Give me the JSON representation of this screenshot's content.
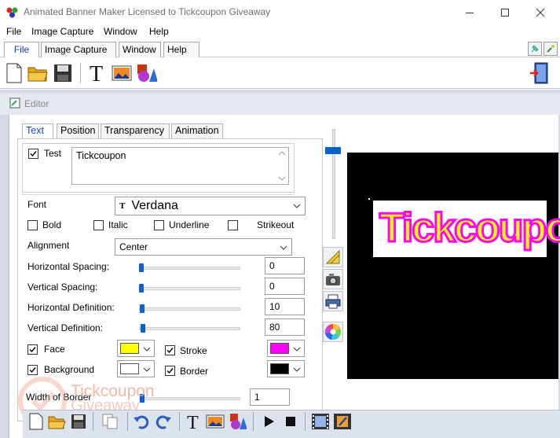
{
  "window": {
    "title": "Animated Banner Maker Licensed to Tickcoupon Giveaway",
    "controls": [
      "minimize",
      "maximize",
      "close"
    ]
  },
  "menubar": [
    "File",
    "Image Capture",
    "Window",
    "Help"
  ],
  "ribbon_tabs": [
    {
      "label": "File",
      "active": true
    },
    {
      "label": "Image Capture",
      "active": false
    },
    {
      "label": "Window",
      "active": false
    },
    {
      "label": "Help",
      "active": false
    }
  ],
  "toolbar": {
    "icons": [
      "new-file-icon",
      "open-folder-icon",
      "save-icon",
      "text-tool-icon",
      "image-icon",
      "shapes-icon"
    ],
    "right_icon": "exit-door-icon"
  },
  "editor": {
    "title": "Editor",
    "tabs": [
      {
        "label": "Text",
        "active": true
      },
      {
        "label": "Position",
        "active": false
      },
      {
        "label": "Transparency",
        "active": false
      },
      {
        "label": "Animation",
        "active": false
      }
    ],
    "text": {
      "checkbox_label": "Test",
      "checked": true,
      "value": "Tickcoupon"
    },
    "font": {
      "label": "Font",
      "value": "Verdana"
    },
    "styles": [
      {
        "label": "Bold",
        "checked": false
      },
      {
        "label": "Italic",
        "checked": false
      },
      {
        "label": "Underline",
        "checked": false
      },
      {
        "label": "Strikeout",
        "checked": false
      }
    ],
    "alignment": {
      "label": "Alignment",
      "value": "Center"
    },
    "sliders": [
      {
        "label": "Horizontal Spacing:",
        "value": "0"
      },
      {
        "label": "Vertical Spacing:",
        "value": "0"
      },
      {
        "label": "Horizontal Definition:",
        "value": "10"
      },
      {
        "label": "Vertical Definition:",
        "value": "80"
      }
    ],
    "colors": {
      "face": {
        "label": "Face",
        "checked": true,
        "color": "#ffff00"
      },
      "stroke": {
        "label": "Stroke",
        "checked": true,
        "color": "#ff00ff"
      },
      "background": {
        "label": "Background",
        "checked": true,
        "color": "#ffffff"
      },
      "border": {
        "label": "Border",
        "checked": true,
        "color": "#000000"
      }
    },
    "border_width": {
      "label": "Width of Border",
      "value": "1"
    }
  },
  "preview": {
    "banner_text": "Tickcoupon",
    "background": "#000000",
    "text_fill": "#ffff00",
    "text_stroke": "#ff00ff"
  },
  "side_buttons": [
    "ruler-icon",
    "camera-icon",
    "printer-icon",
    "color-wheel-icon"
  ],
  "bottom_toolbar": [
    "new-icon",
    "open-icon",
    "save-icon",
    "copy-icon",
    "undo-icon",
    "redo-icon",
    "text-icon",
    "image-icon",
    "shapes-icon",
    "play-icon",
    "stop-icon",
    "film-icon",
    "film-edit-icon"
  ],
  "watermark": {
    "line1": "Tickcoupon",
    "line2": "Giveaway"
  }
}
